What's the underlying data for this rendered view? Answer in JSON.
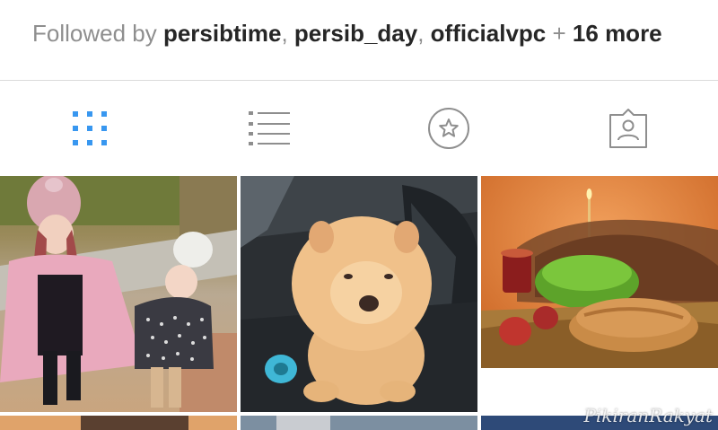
{
  "profile": {
    "followed_prefix": "Followed by ",
    "followers": [
      "persibtime",
      "persib_day",
      "officialvpc"
    ],
    "separator": ", ",
    "more": "+ 16 more"
  },
  "tabs": [
    {
      "icon": "grid-icon",
      "active": true
    },
    {
      "icon": "list-icon",
      "active": false
    },
    {
      "icon": "star-icon",
      "active": false
    },
    {
      "icon": "tagged-icon",
      "active": false
    }
  ],
  "colors": {
    "active_tab": "#3897f0",
    "inactive_icon": "#8e8e8e",
    "text": "#262626",
    "muted": "#8e8e8e"
  },
  "posts": [
    {
      "subject": "two girls in winter coats"
    },
    {
      "subject": "chow chow puppy in car seat"
    },
    {
      "subject": "holiday bread with wheatgrass and candle"
    }
  ],
  "watermark": "PikiranRakyat"
}
